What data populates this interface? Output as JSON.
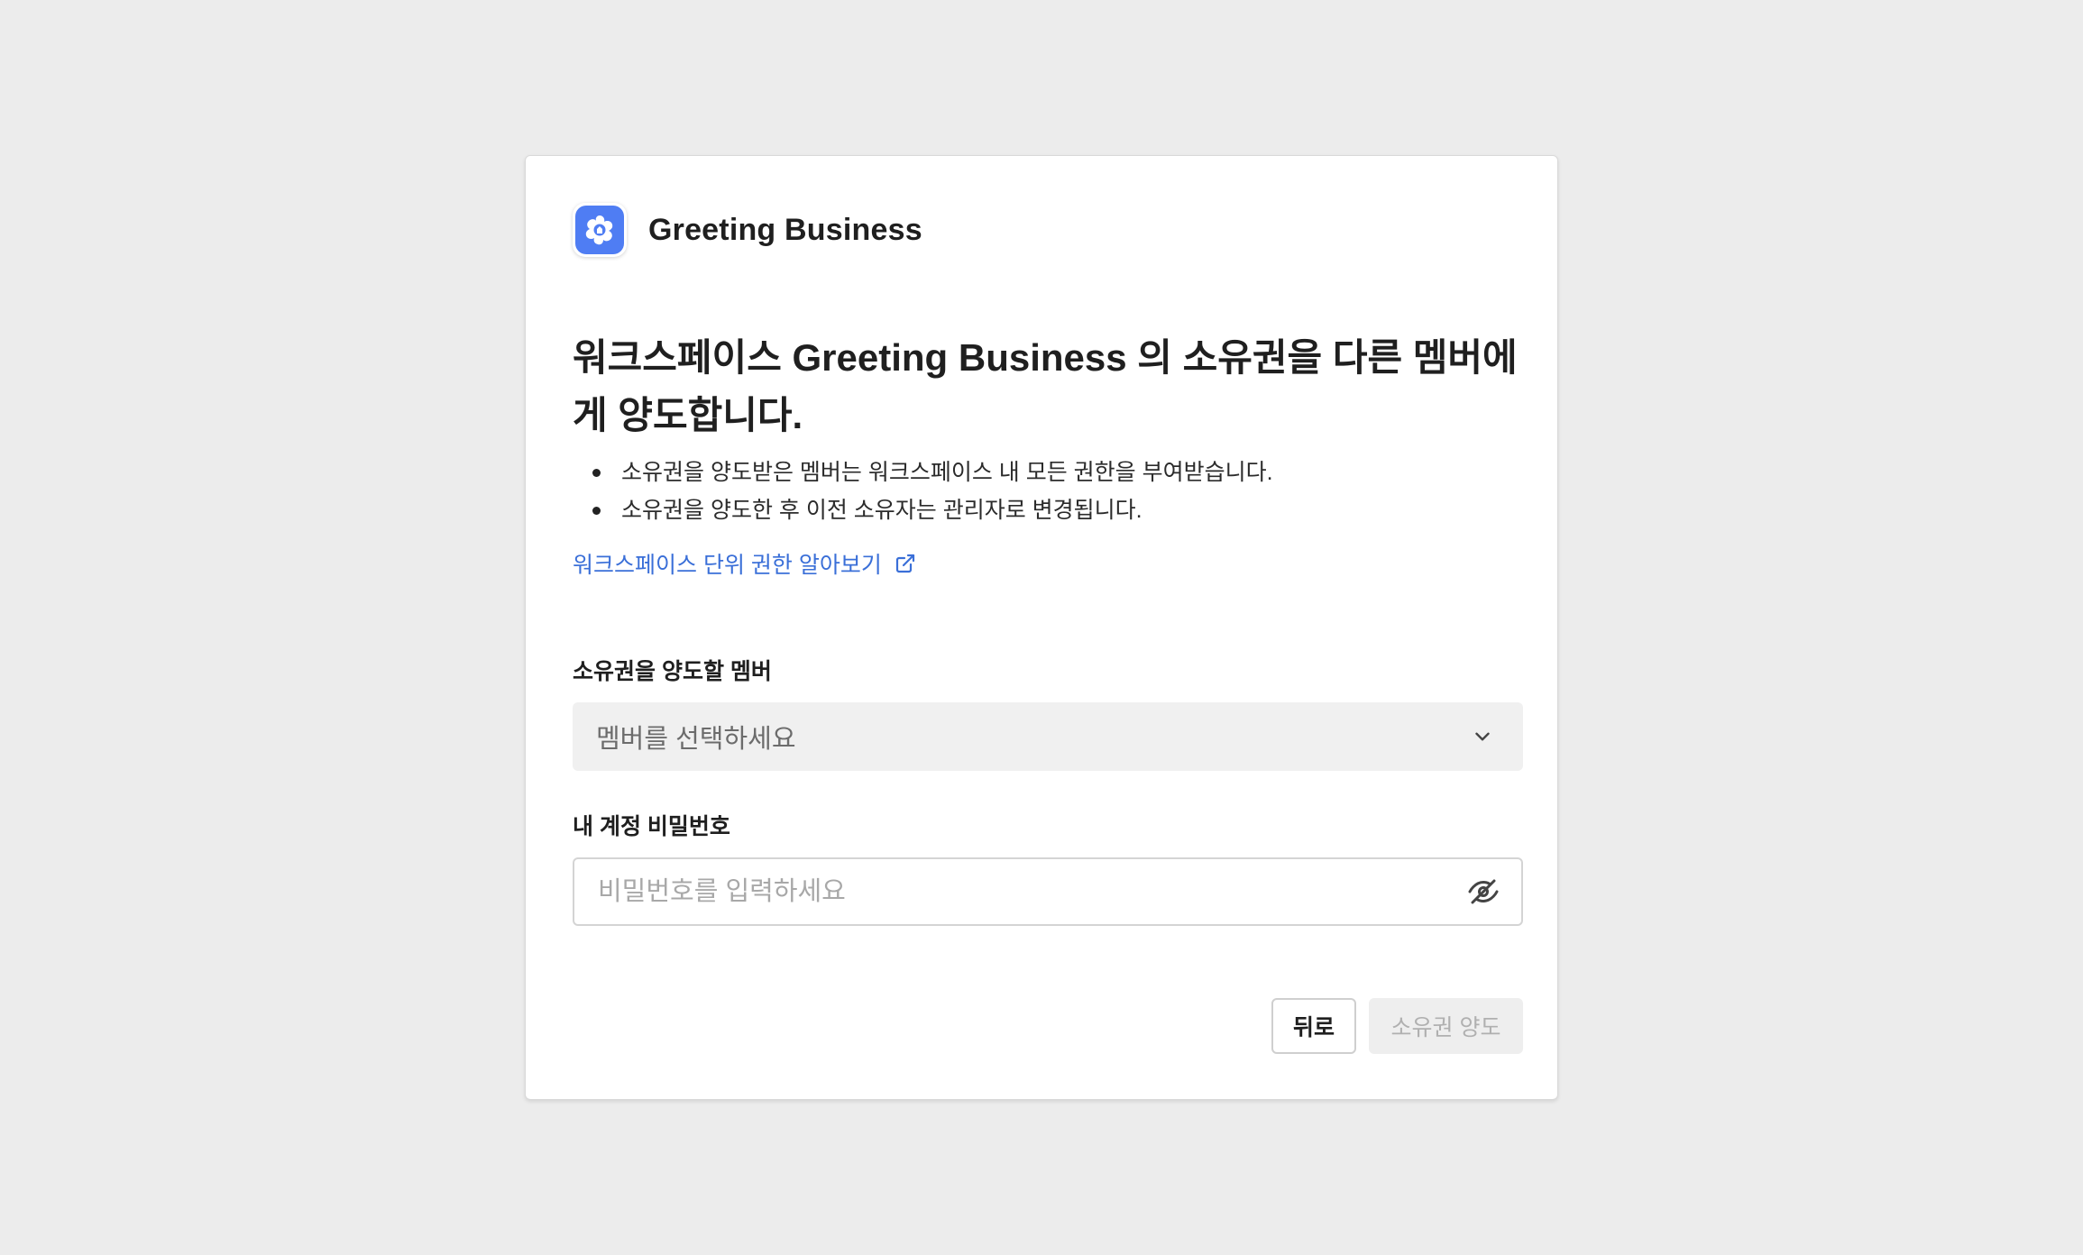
{
  "brand": {
    "name": "Greeting Business",
    "logo_icon": "greeting-logo-icon",
    "logo_color": "#4f7df3"
  },
  "dialog": {
    "heading": "워크스페이스 Greeting Business 의 소유권을 다른 멤버에게 양도합니다.",
    "bullets": [
      "소유권을 양도받은 멤버는 워크스페이스 내 모든 권한을 부여받습니다.",
      "소유권을 양도한 후 이전 소유자는 관리자로 변경됩니다."
    ],
    "learn_link": "워크스페이스 단위 권한 알아보기",
    "link_color": "#3a6fd8"
  },
  "member_field": {
    "label": "소유권을 양도할 멤버",
    "placeholder": "멤버를 선택하세요"
  },
  "password_field": {
    "label": "내 계정 비밀번호",
    "placeholder": "비밀번호를 입력하세요"
  },
  "actions": {
    "back_label": "뒤로",
    "transfer_label": "소유권 양도"
  }
}
